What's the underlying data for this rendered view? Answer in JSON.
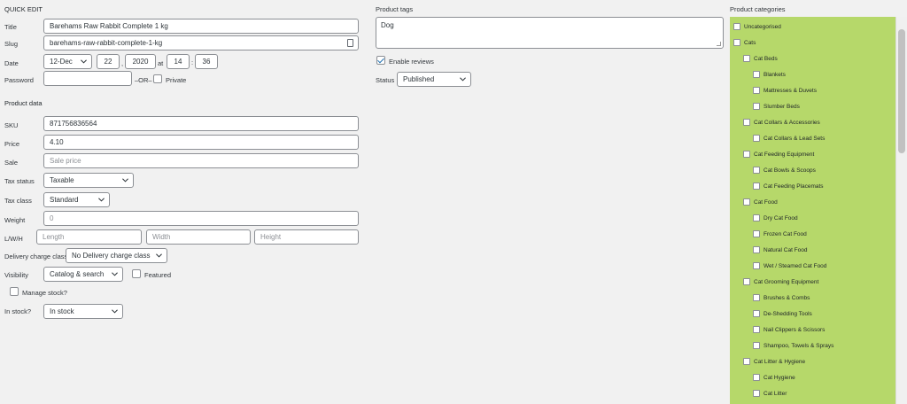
{
  "left": {
    "heading": "QUICK EDIT",
    "title_label": "Title",
    "title_value": "Barehams Raw Rabbit Complete 1 kg",
    "slug_label": "Slug",
    "slug_value": "barehams-raw-rabbit-complete-1-kg",
    "date_label": "Date",
    "month_value": "12-Dec",
    "day_value": "22",
    "year_value": "2020",
    "at_label": "at",
    "hour_value": "14",
    "minute_value": "36",
    "password_label": "Password",
    "or_label": "–OR–",
    "private_label": "Private"
  },
  "product_data": {
    "heading": "Product data",
    "sku_label": "SKU",
    "sku_value": "871756836564",
    "price_label": "Price",
    "price_value": "4.10",
    "sale_label": "Sale",
    "sale_placeholder": "Sale price",
    "tax_status_label": "Tax status",
    "tax_status_value": "Taxable",
    "tax_class_label": "Tax class",
    "tax_class_value": "Standard",
    "weight_label": "Weight",
    "weight_placeholder": "0",
    "lwh_label": "L/W/H",
    "length_placeholder": "Length",
    "width_placeholder": "Width",
    "height_placeholder": "Height",
    "delivery_label": "Delivery charge class",
    "delivery_value": "No Delivery charge class",
    "visibility_label": "Visibility",
    "visibility_value": "Catalog & search",
    "featured_label": "Featured",
    "manage_stock_label": "Manage stock?",
    "in_stock_label": "In stock?",
    "in_stock_value": "In stock"
  },
  "middle": {
    "tags_heading": "Product tags",
    "tags_value": "Dog",
    "enable_reviews_label": "Enable reviews",
    "enable_reviews_checked": true,
    "status_label": "Status",
    "status_value": "Published"
  },
  "categories": {
    "heading": "Product categories",
    "bg_color": "#b6d86a",
    "items": [
      {
        "label": "Uncategorised",
        "level": 0
      },
      {
        "label": "Cats",
        "level": 0
      },
      {
        "label": "Cat Beds",
        "level": 1
      },
      {
        "label": "Blankets",
        "level": 2
      },
      {
        "label": "Mattresses & Duvets",
        "level": 2
      },
      {
        "label": "Slumber Beds",
        "level": 2
      },
      {
        "label": "Cat Collars & Accessories",
        "level": 1
      },
      {
        "label": "Cat Collars & Lead Sets",
        "level": 2
      },
      {
        "label": "Cat Feeding Equipment",
        "level": 1
      },
      {
        "label": "Cat Bowls & Scoops",
        "level": 2
      },
      {
        "label": "Cat Feeding Placemats",
        "level": 2
      },
      {
        "label": "Cat Food",
        "level": 1
      },
      {
        "label": "Dry Cat Food",
        "level": 2
      },
      {
        "label": "Frozen Cat Food",
        "level": 2
      },
      {
        "label": "Natural Cat Food",
        "level": 2
      },
      {
        "label": "Wet / Steamed Cat Food",
        "level": 2
      },
      {
        "label": "Cat Grooming Equipment",
        "level": 1
      },
      {
        "label": "Brushes & Combs",
        "level": 2
      },
      {
        "label": "De-Shedding Tools",
        "level": 2
      },
      {
        "label": "Nail Clippers & Scissors",
        "level": 2
      },
      {
        "label": "Shampoo, Towels & Sprays",
        "level": 2
      },
      {
        "label": "Cat Litter & Hygiene",
        "level": 1
      },
      {
        "label": "Cat Hygiene",
        "level": 2
      },
      {
        "label": "Cat Litter",
        "level": 2
      }
    ]
  }
}
